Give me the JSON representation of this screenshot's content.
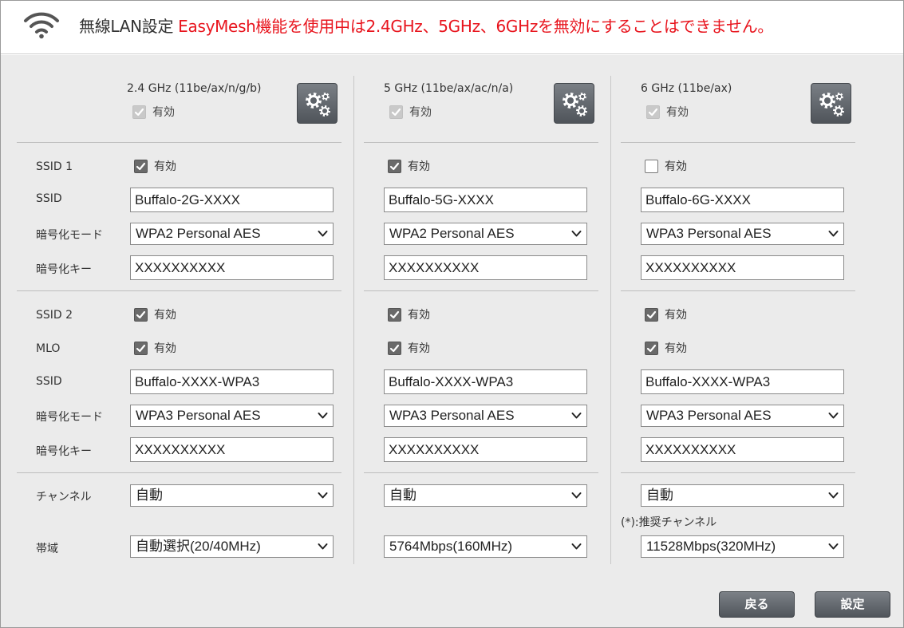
{
  "header": {
    "title": "無線LAN設定",
    "warning": "EasyMesh機能を使用中は2.4GHz、5GHz、6GHzを無効にすることはできません。"
  },
  "icons": {
    "wifi": "wifi-icon",
    "gear": "gear-settings-icon",
    "check": "checkmark-icon",
    "chevron": "chevron-down-icon"
  },
  "labels": {
    "ssid1": "SSID 1",
    "ssid": "SSID",
    "encryption_mode": "暗号化モード",
    "encryption_key": "暗号化キー",
    "ssid2": "SSID 2",
    "mlo": "MLO",
    "channel": "チャンネル",
    "bandwidth": "帯域"
  },
  "enable_label": "有効",
  "bands": [
    {
      "title": "2.4 GHz (11be/ax/n/g/b)",
      "enabled": true,
      "ssid1": {
        "enabled": true,
        "ssid": "Buffalo-2G-XXXX",
        "mode": "WPA2 Personal AES",
        "key": "XXXXXXXXXX"
      },
      "ssid2": {
        "enabled": true,
        "mlo": true,
        "ssid": "Buffalo-XXXX-WPA3",
        "mode": "WPA3 Personal AES",
        "key": "XXXXXXXXXX"
      },
      "channel": "自動",
      "bandwidth": "自動選択(20/40MHz)"
    },
    {
      "title": "5 GHz (11be/ax/ac/n/a)",
      "enabled": true,
      "ssid1": {
        "enabled": true,
        "ssid": "Buffalo-5G-XXXX",
        "mode": "WPA2 Personal AES",
        "key": "XXXXXXXXXX"
      },
      "ssid2": {
        "enabled": true,
        "mlo": true,
        "ssid": "Buffalo-XXXX-WPA3",
        "mode": "WPA3 Personal AES",
        "key": "XXXXXXXXXX"
      },
      "channel": "自動",
      "bandwidth": "5764Mbps(160MHz)"
    },
    {
      "title": "6 GHz (11be/ax)",
      "enabled": true,
      "ssid1": {
        "enabled": false,
        "ssid": "Buffalo-6G-XXXX",
        "mode": "WPA3 Personal AES",
        "key": "XXXXXXXXXX"
      },
      "ssid2": {
        "enabled": true,
        "mlo": true,
        "ssid": "Buffalo-XXXX-WPA3",
        "mode": "WPA3 Personal AES",
        "key": "XXXXXXXXXX"
      },
      "channel": "自動",
      "channel_note": "(*):推奨チャンネル",
      "bandwidth": "11528Mbps(320MHz)"
    }
  ],
  "buttons": {
    "back": "戻る",
    "apply": "設定"
  },
  "colors": {
    "warning": "#e8141d",
    "panel": "#ebebeb",
    "button": "#5f646a"
  }
}
